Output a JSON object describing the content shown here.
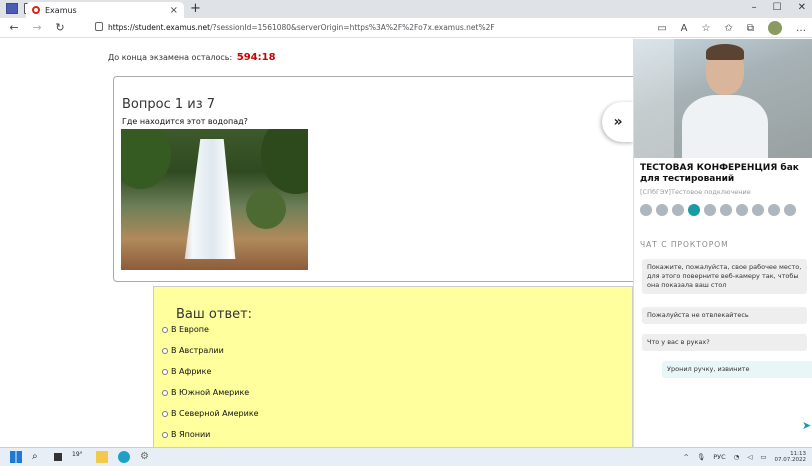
{
  "browser": {
    "tab_title": "Examus",
    "tab_close": "×",
    "new_tab": "+",
    "window_controls": [
      "–",
      "☐",
      "✕"
    ],
    "url_host": "https://student.examus.net",
    "url_path": "/?sessionId=1561080&serverOrigin=https%3A%2F%2Fo7x.examus.net%2F",
    "icons": [
      "back-icon",
      "forward-icon",
      "refresh-icon",
      "lock-icon",
      "reader-icon",
      "read-aloud-icon",
      "favorite-icon",
      "favorites-icon",
      "collections-icon",
      "profile-icon",
      "more-icon"
    ]
  },
  "exam": {
    "timer_label": "До конца экзамена осталось:",
    "timer_value": "594:18",
    "question_counter": "Вопрос 1 из 7",
    "question_text": "Где находится этот водопад?",
    "answer_title": "Ваш ответ:",
    "options": [
      "В Европе",
      "В Австралии",
      "В Африке",
      "В Южной Америке",
      "В Северной Америке",
      "В Японии"
    ],
    "expand_button": "»"
  },
  "proctor": {
    "conference_title": "ТЕСТОВАЯ КОНФЕРЕНЦИЯ бак для тестирований",
    "conference_subtitle": "[СПбГЭУ]Тестовое подключение",
    "controls_count_note": "",
    "chat_header": "ЧАТ С ПРОКТОРОМ",
    "messages": [
      {
        "text": "Покажите, пожалуйста, свое рабочее место, для этого поверните веб-камеру так, чтобы она показала ваш стол",
        "own": false
      },
      {
        "text": "Пожалуйста не отвлекайтесь",
        "own": false
      },
      {
        "text": "Что у вас в руках?",
        "own": false
      },
      {
        "text": "Уронил ручку, извините",
        "own": true
      }
    ]
  },
  "taskbar": {
    "weather": "19°",
    "lang": "РУС",
    "time": "11:13",
    "date": "07.07.2022"
  }
}
